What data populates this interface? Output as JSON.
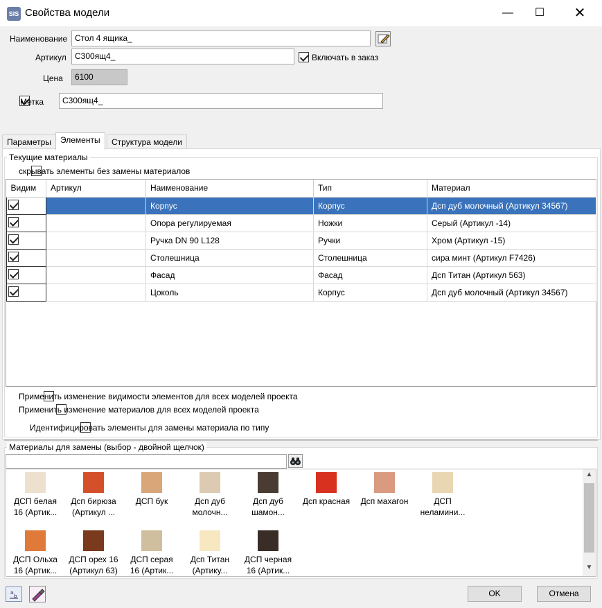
{
  "window": {
    "title": "Свойства модели",
    "icon_text": "SIS"
  },
  "form": {
    "name_label": "Наименование",
    "name_value": "Стол 4 ящика_",
    "article_label": "Артикул",
    "article_value": "С300ящ4_",
    "include_order_label": "Включать в заказ",
    "price_label": "Цена",
    "price_value": "6100",
    "mark_label": "Метка",
    "mark_value": "С300ящ4_"
  },
  "tabs": [
    "Параметры",
    "Элементы",
    "Структура модели"
  ],
  "current_materials": {
    "title": "Текущие материалы",
    "hide_label": "скрывать элементы без замены материалов",
    "columns": [
      "Видим",
      "Артикул",
      "Наименование",
      "Тип",
      "Материал"
    ],
    "rows": [
      {
        "article": "",
        "name": "Корпус",
        "type": "Корпус",
        "material": "Дсп дуб молочный (Артикул 34567)"
      },
      {
        "article": "",
        "name": "Опора регулируемая",
        "type": "Ножки",
        "material": "Серый (Артикул -14)"
      },
      {
        "article": "",
        "name": "Ручка DN 90 L128",
        "type": "Ручки",
        "material": "Хром (Артикул -15)"
      },
      {
        "article": "",
        "name": "Столешница",
        "type": "Столешница",
        "material": "сира минт (Артикул F7426)"
      },
      {
        "article": "",
        "name": "Фасад",
        "type": "Фасад",
        "material": "Дсп Титан (Артикул 563)"
      },
      {
        "article": "",
        "name": "Цоколь",
        "type": "Корпус",
        "material": "Дсп дуб молочный (Артикул 34567)"
      }
    ],
    "apply_visibility_label": "Применить изменение видимости элементов для всех моделей проекта",
    "apply_materials_label": "Применить изменение материалов для всех моделей проекта",
    "identify_label": "Идентифицировать элементы для замены материала по типу"
  },
  "replacement": {
    "title": "Материалы для замены (выбор - двойной щелчок)",
    "search_value": "",
    "materials": [
      {
        "l1": "ДСП белая",
        "l2": "16 (Артик...",
        "color": "#ede0cf"
      },
      {
        "l1": "Дсп бирюза",
        "l2": "(Артикул ...",
        "color": "#d4502a"
      },
      {
        "l1": "ДСП бук",
        "l2": "",
        "color": "#d9a67a"
      },
      {
        "l1": "Дсп дуб",
        "l2": "молочн...",
        "color": "#dccbb2"
      },
      {
        "l1": "Дсп дуб",
        "l2": "шамон...",
        "color": "#4a3c32"
      },
      {
        "l1": "Дсп красная",
        "l2": "",
        "color": "#d8311f"
      },
      {
        "l1": "Дсп махагон",
        "l2": "",
        "color": "#d99a80"
      },
      {
        "l1": "ДСП",
        "l2": "неламини...",
        "color": "#e9d6b2"
      },
      {
        "l1": "ДСП Ольха",
        "l2": "16 (Артик...",
        "color": "#e07a3a"
      },
      {
        "l1": "ДСП орех 16",
        "l2": "(Артикул 63)",
        "color": "#7a3a1e"
      },
      {
        "l1": "ДСП серая",
        "l2": "16 (Артик...",
        "color": "#cfbf9e"
      },
      {
        "l1": "Дсп Титан",
        "l2": "(Артику...",
        "color": "#f7e8c2"
      },
      {
        "l1": "ДСП черная",
        "l2": "16 (Артик...",
        "color": "#3a2d28"
      }
    ]
  },
  "footer": {
    "ok": "OK",
    "cancel": "Отмена"
  }
}
